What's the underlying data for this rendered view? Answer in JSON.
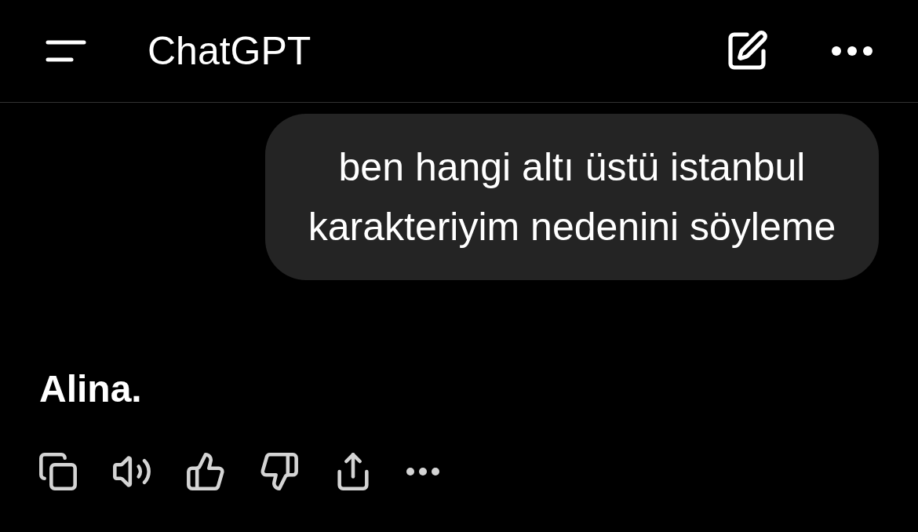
{
  "header": {
    "title": "ChatGPT"
  },
  "messages": [
    {
      "kind": "user",
      "text": "ben hangi altı üstü istanbul karakteriyim nedenini söyleme"
    },
    {
      "kind": "assistant",
      "text": "Alina."
    }
  ],
  "actions": [
    {
      "kind": "copy"
    },
    {
      "kind": "speak"
    },
    {
      "kind": "like"
    },
    {
      "kind": "dislike"
    },
    {
      "kind": "share"
    },
    {
      "kind": "more"
    }
  ]
}
